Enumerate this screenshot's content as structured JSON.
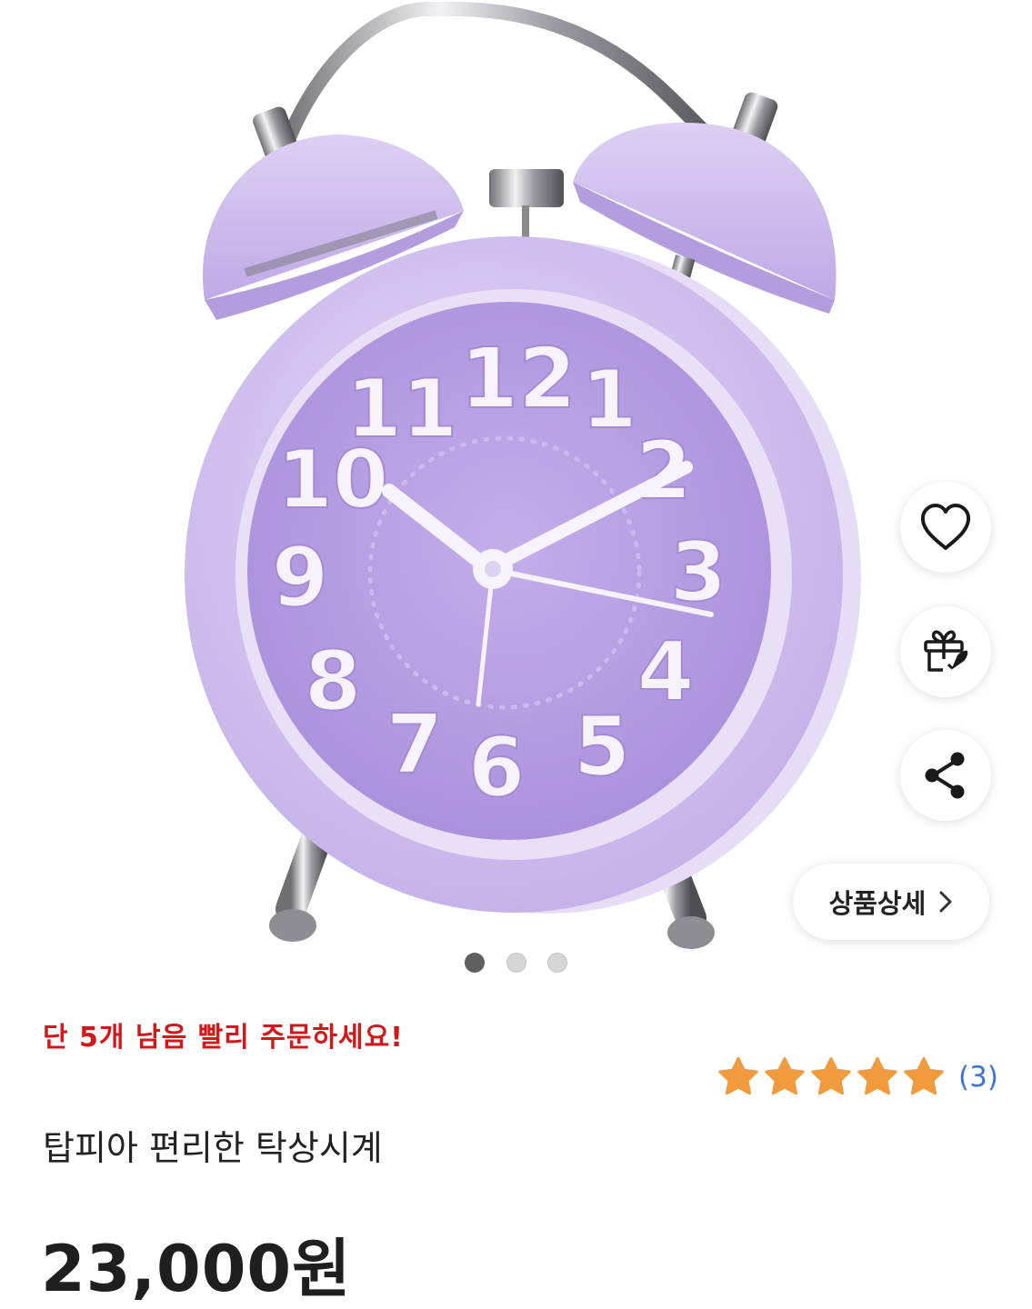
{
  "gallery": {
    "image_alt": "보라색 트윈벨 알람 탁상시계",
    "dial_numbers": [
      "12",
      "1",
      "2",
      "3",
      "4",
      "5",
      "6",
      "7",
      "8",
      "9",
      "10",
      "11"
    ],
    "page_count": 3,
    "active_page": 1,
    "detail_label": "상품상세"
  },
  "actions": {
    "like_icon": "heart-icon",
    "gift_icon": "gift-icon",
    "share_icon": "share-icon"
  },
  "product": {
    "urgency": "단 5개 남음 빨리 주문하세요!",
    "rating": 5,
    "review_count": "(3)",
    "title": "탑피아 편리한 탁상시계",
    "price": "23,000원"
  },
  "colors": {
    "urgency": "#d0191b",
    "star": "#f29a3e",
    "review_count": "#3d74d6",
    "clock_body": "#d7c3f0",
    "clock_face": "#b9a0e4"
  }
}
